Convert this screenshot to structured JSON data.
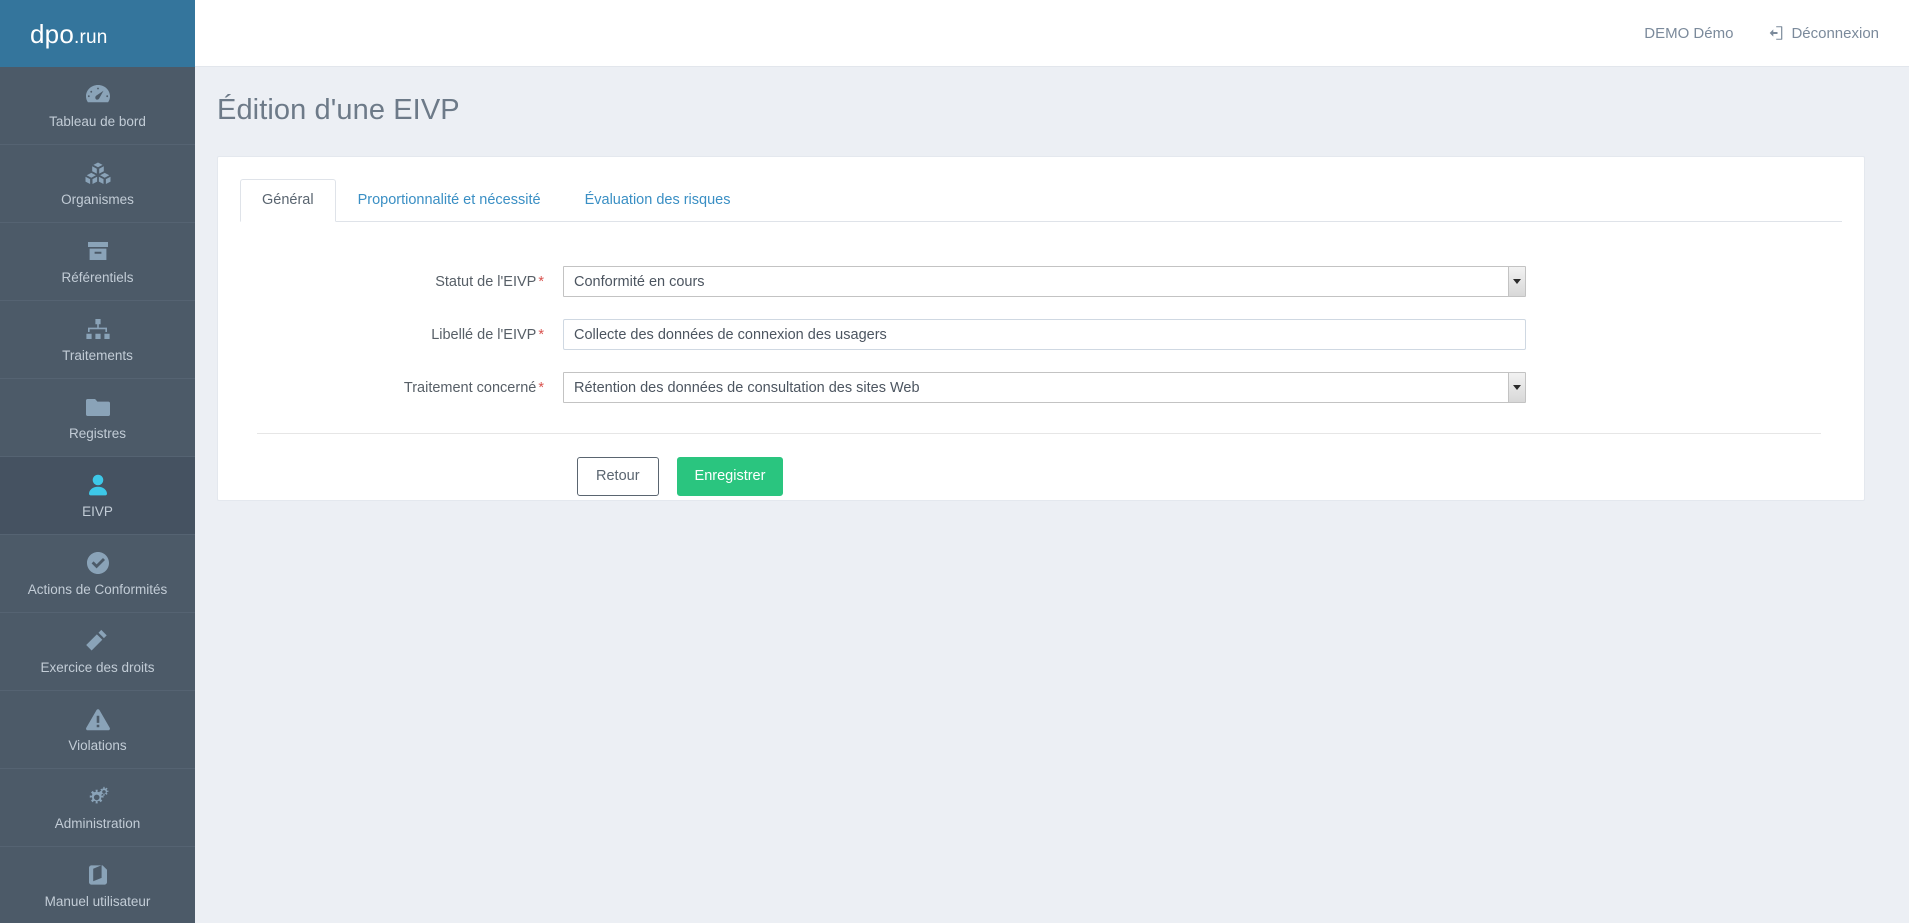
{
  "brand": {
    "logo_main": "dpo",
    "logo_suffix": ".run",
    "header_color": "#34759c",
    "sidebar_color": "#4c5a68",
    "accent_color": "#3dc8e8",
    "save_color": "#2ac57f"
  },
  "header": {
    "user_name": "DEMO Démo",
    "logout_label": "Déconnexion",
    "logout_icon": "sign-out-icon",
    "menu_toggle_icon": "hamburger-icon"
  },
  "sidebar": {
    "items": [
      {
        "label": "Tableau de bord",
        "icon": "dashboard-gauge-icon",
        "active": false
      },
      {
        "label": "Organismes",
        "icon": "cubes-icon",
        "active": false
      },
      {
        "label": "Référentiels",
        "icon": "archive-box-icon",
        "active": false
      },
      {
        "label": "Traitements",
        "icon": "sitemap-icon",
        "active": false
      },
      {
        "label": "Registres",
        "icon": "folder-icon",
        "active": false
      },
      {
        "label": "EIVP",
        "icon": "user-icon",
        "active": true
      },
      {
        "label": "Actions de Conformités",
        "icon": "check-circle-icon",
        "active": false
      },
      {
        "label": "Exercice des droits",
        "icon": "gavel-icon",
        "active": false
      },
      {
        "label": "Violations",
        "icon": "warning-triangle-icon",
        "active": false
      },
      {
        "label": "Administration",
        "icon": "gears-icon",
        "active": false
      },
      {
        "label": "Manuel utilisateur",
        "icon": "book-icon",
        "active": false
      }
    ]
  },
  "main": {
    "page_title": "Édition d'une EIVP",
    "tabs": [
      {
        "label": "Général",
        "active": true
      },
      {
        "label": "Proportionnalité et nécessité",
        "active": false
      },
      {
        "label": "Évaluation des risques",
        "active": false
      }
    ],
    "form": {
      "required_marker": "*",
      "fields": [
        {
          "label": "Statut de l'EIVP",
          "type": "select",
          "value": "Conformité en cours",
          "required": true
        },
        {
          "label": "Libellé de l'EIVP",
          "type": "text",
          "value": "Collecte des données de connexion des usagers",
          "placeholder": "",
          "required": true
        },
        {
          "label": "Traitement concerné",
          "type": "select",
          "value": "Rétention des données de consultation des sites Web",
          "required": true
        }
      ],
      "buttons": {
        "back_label": "Retour",
        "save_label": "Enregistrer"
      }
    }
  }
}
